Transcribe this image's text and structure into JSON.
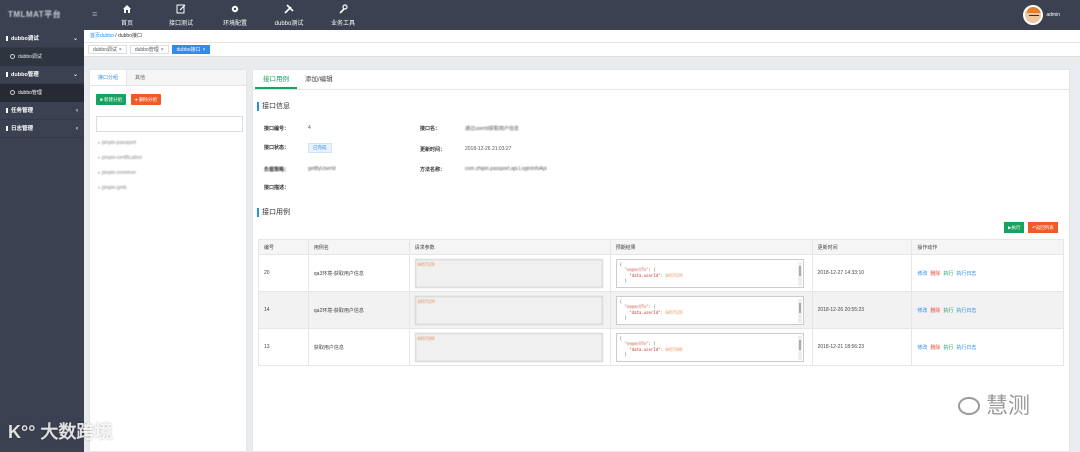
{
  "app": {
    "brand": "TMLMAT平台",
    "user": "admin"
  },
  "nav": [
    {
      "label": "首页",
      "icon": "home-icon"
    },
    {
      "label": "接口测试",
      "icon": "edit-icon"
    },
    {
      "label": "环境配置",
      "icon": "gear-icon"
    },
    {
      "label": "dubbo测试",
      "icon": "tools-icon"
    },
    {
      "label": "业务工具",
      "icon": "wrench-icon"
    }
  ],
  "sidebar": {
    "groups": [
      {
        "label": "dubbo调试",
        "sub": "dubbo调试"
      },
      {
        "label": "dubbo管理",
        "sub": "dubbo管理"
      },
      {
        "label": "任务管理"
      },
      {
        "label": "日志管理"
      }
    ]
  },
  "breadcrumb": {
    "home": "首页dubbo",
    "sep": "/",
    "current": "dubbo接口"
  },
  "tabs": [
    {
      "label": "dubbo调试"
    },
    {
      "label": "dubbo管理"
    },
    {
      "label": "dubbo接口"
    }
  ],
  "left": {
    "tab_active": "接口分组",
    "tab_other": "其他",
    "btn_new": "新建分组",
    "btn_del": "删除分组",
    "tree": [
      "pinpin-passport",
      "pinpin-certification",
      "pinpin-common",
      "pinpin-gmb"
    ]
  },
  "main": {
    "tab_active": "接口用例",
    "tab_other": "添加/编辑",
    "section_info": "接口信息",
    "section_cases": "接口用例",
    "info": {
      "id_label": "接口编号：",
      "id_value": "4",
      "name_label": "接口名：",
      "name_value": "通过userId获取用户信息",
      "status_label": "接口状态：",
      "status_value": "已完成",
      "updated_label": "更新时间：",
      "updated_value": "2018-12-26 21:03:27",
      "type_label": "负载策略：",
      "type_value": "getByUserId",
      "method_label": "方法名称：",
      "method_value": "com.zhipin.passport.api.LoginInfoApi",
      "desc_label": "接口描述："
    },
    "btn_run": "▶执行",
    "btn_back": "↶返回列表",
    "table": {
      "headers": [
        "编号",
        "用例名",
        "请求参数",
        "预期结果",
        "更新时间",
        "操作动作"
      ],
      "rows": [
        {
          "id": "20",
          "name": "qa3环境-获取用户信息",
          "param": "6457129",
          "exp_k": "\"expectTo\"",
          "exp_v": "6457129",
          "time": "2018-12-27 14:33:10"
        },
        {
          "id": "14",
          "name": "qa2环境-获取用户信息",
          "param": "6457129",
          "exp_k": "\"expectTo\"",
          "exp_v": "6457129",
          "time": "2018-12-26 20:55:23"
        },
        {
          "id": "13",
          "name": "获取用户信息",
          "param": "6457348",
          "exp_k": "\"expectTo\"",
          "exp_v": "6457348",
          "time": "2018-12-21 18:56:23"
        }
      ],
      "ops": [
        "修改",
        "删除",
        "执行",
        "执行日志"
      ],
      "exp_key2": "\"data.userId\""
    }
  },
  "watermarks": {
    "left": "大数跨境",
    "right": "慧测"
  }
}
